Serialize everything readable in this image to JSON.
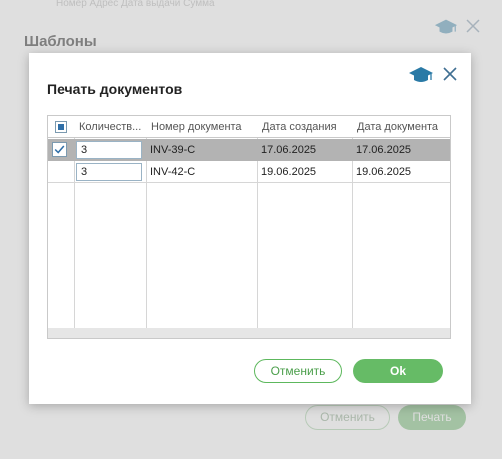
{
  "background_dialog": {
    "title": "Шаблоны",
    "top_strip_text": "Номер Адрес   Дата выдачи   Сумма",
    "cancel_label": "Отменить",
    "print_label": "Печать"
  },
  "modal": {
    "title": "Печать документов",
    "help_icon": "graduation-cap-icon",
    "close_icon": "close-icon",
    "columns": [
      "Количеств...",
      "Номер документа",
      "Дата создания",
      "Дата документа"
    ],
    "header_checkbox_state": "partial",
    "rows": [
      {
        "checked": true,
        "quantity": "3",
        "doc_number": "INV-39-C",
        "created": "17.06.2025",
        "doc_date": "17.06.2025",
        "selected": true
      },
      {
        "checked": false,
        "quantity": "3",
        "doc_number": "INV-42-C",
        "created": "19.06.2025",
        "doc_date": "19.06.2025",
        "selected": false
      }
    ],
    "cancel_label": "Отменить",
    "ok_label": "Ok"
  },
  "colors": {
    "accent_green": "#66bb66",
    "accent_blue": "#2f6fa8",
    "selected_row": "#b3b3b3"
  }
}
